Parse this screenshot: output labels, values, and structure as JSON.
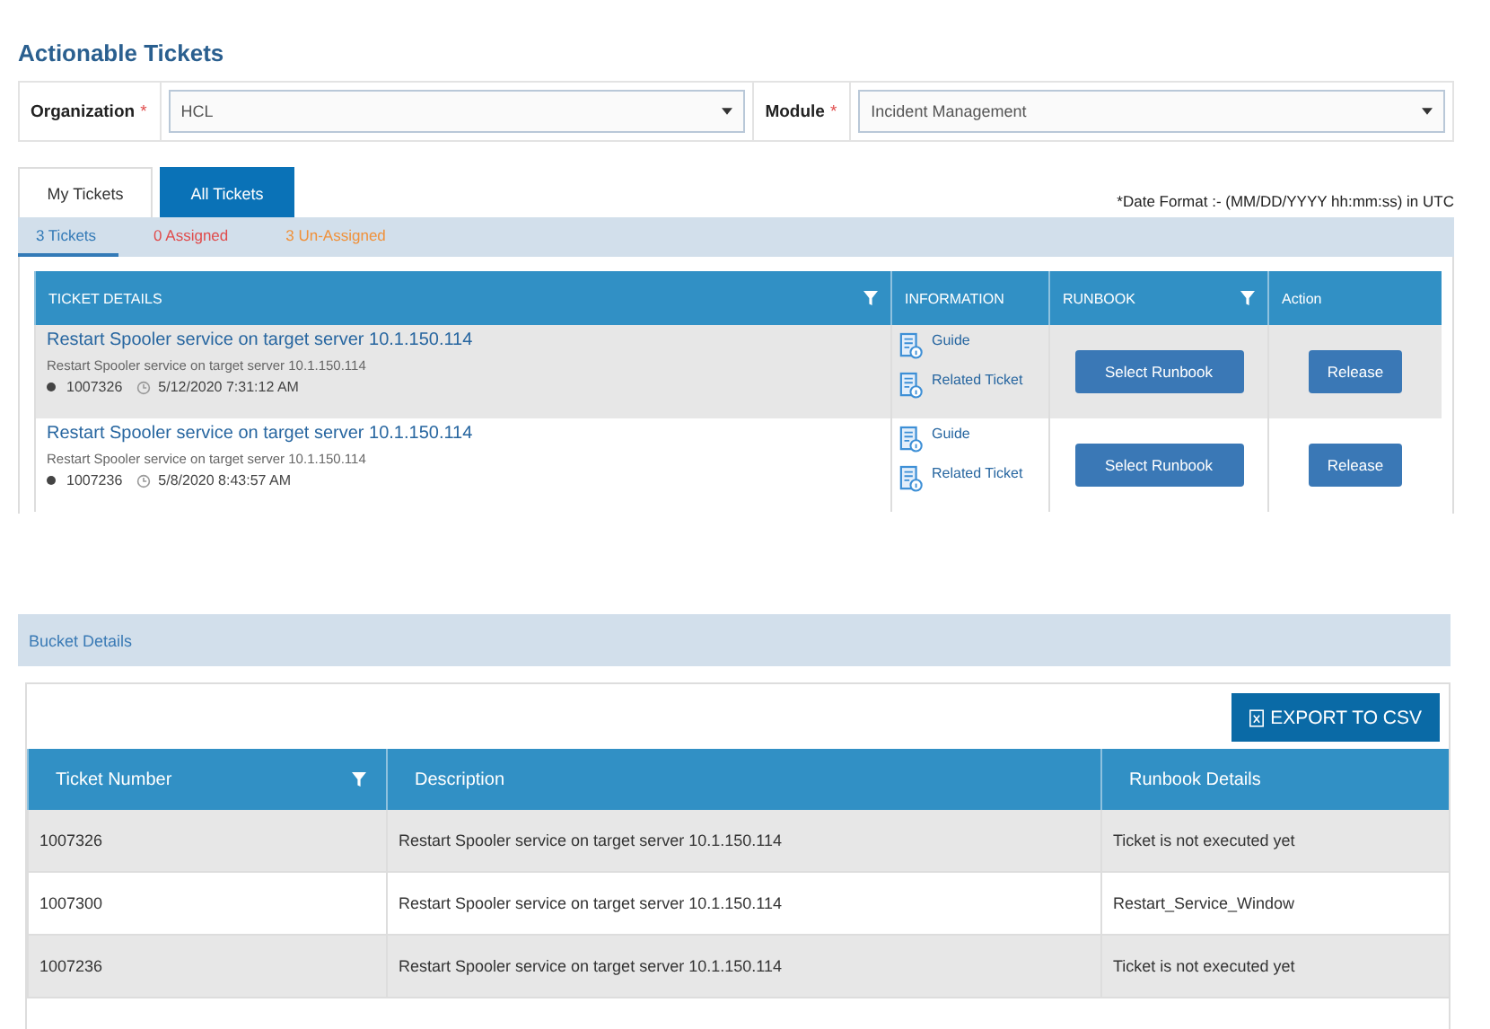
{
  "page_title": "Actionable Tickets",
  "filters": [
    {
      "label": "Organization",
      "required_mark": "*",
      "value": "HCL"
    },
    {
      "label": "Module",
      "required_mark": "*",
      "value": "Incident Management"
    }
  ],
  "tabs": [
    {
      "label": "My Tickets",
      "selected": false
    },
    {
      "label": "All Tickets",
      "selected": true
    }
  ],
  "date_format_note": "*Date Format :- (MM/DD/YYYY hh:mm:ss) in UTC",
  "sub_tabs": [
    {
      "label": "3 Tickets",
      "selected": true,
      "color": "#337ab7"
    },
    {
      "label": "0 Assigned",
      "selected": false,
      "color": "#e04b4b"
    },
    {
      "label": "3 Un-Assigned",
      "selected": false,
      "color": "#f0913a"
    }
  ],
  "ticket_table": {
    "columns": [
      {
        "label": "TICKET DETAILS",
        "filter": true
      },
      {
        "label": "INFORMATION",
        "filter": false
      },
      {
        "label": "RUNBOOK",
        "filter": true
      },
      {
        "label": "Action",
        "filter": false
      }
    ],
    "rows": [
      {
        "title": "Restart Spooler service on target server 10.1.150.114",
        "description": "Restart Spooler service on target server 10.1.150.114",
        "number": "1007326",
        "time": "5/12/2020 7:31:12 AM",
        "links": [
          "Guide",
          "Related Ticket"
        ],
        "runbook_button": "Select Runbook",
        "action_button": "Release"
      },
      {
        "title": "Restart Spooler service on target server 10.1.150.114",
        "description": "Restart Spooler service on target server 10.1.150.114",
        "number": "1007236",
        "time": "5/8/2020 8:43:57 AM",
        "links": [
          "Guide",
          "Related Ticket"
        ],
        "runbook_button": "Select Runbook",
        "action_button": "Release"
      }
    ]
  },
  "bucket_title": "Bucket Details",
  "export_button": "EXPORT TO CSV",
  "bucket_table": {
    "columns": [
      {
        "label": "Ticket Number",
        "filter": true
      },
      {
        "label": "Description",
        "filter": false
      },
      {
        "label": "Runbook Details",
        "filter": false
      }
    ],
    "rows": [
      [
        "1007326",
        "Restart Spooler service on target server 10.1.150.114",
        "Ticket is not executed yet"
      ],
      [
        "1007300",
        "Restart Spooler service on target server 10.1.150.114",
        "Restart_Service_Window"
      ],
      [
        "1007236",
        "Restart Spooler service on target server 10.1.150.114",
        "Ticket is not executed yet"
      ]
    ]
  }
}
